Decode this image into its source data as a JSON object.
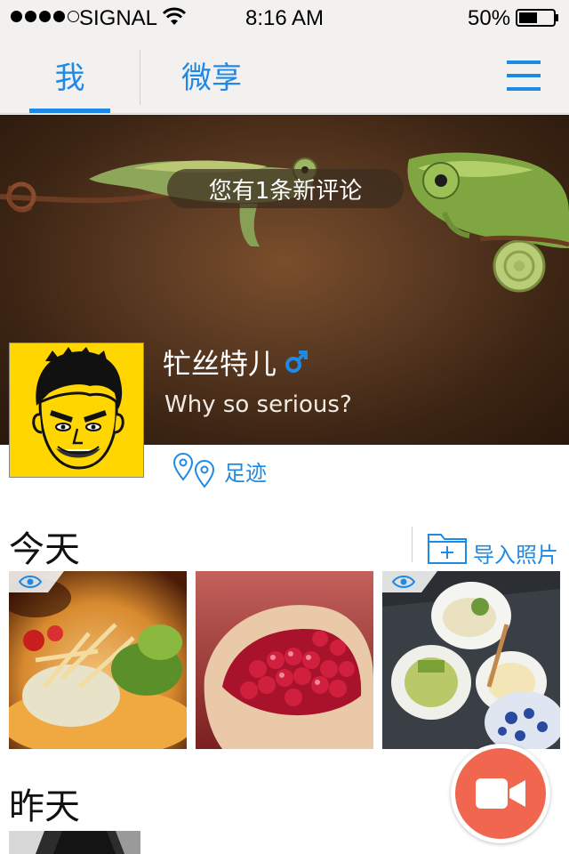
{
  "status_bar": {
    "carrier": "SIGNAL",
    "time": "8:16 AM",
    "battery": "50%"
  },
  "nav": {
    "tabs": [
      {
        "label": "我",
        "active": true
      },
      {
        "label": "微享",
        "active": false
      }
    ],
    "menu_icon": "hamburger-icon"
  },
  "profile": {
    "notification": "您有1条新评论",
    "name": "牤丝特儿",
    "gender_icon": "male-symbol-icon",
    "motto": "Why so serious?",
    "footprint_label": "足迹",
    "footprint_icon": "map-pin-icon"
  },
  "today": {
    "title": "今天",
    "import_label": "导入照片",
    "import_icon": "folder-plus-icon",
    "photos": [
      {
        "subject": "salad dish",
        "eye_badge": true
      },
      {
        "subject": "pomegranate",
        "eye_badge": false
      },
      {
        "subject": "japanese dishes",
        "eye_badge": true
      }
    ]
  },
  "yesterday": {
    "title": "昨天"
  },
  "record_icon": "video-camera-icon",
  "colors": {
    "accent": "#1f8ae6",
    "record": "#f0664f",
    "avatar_bg": "#ffd600"
  }
}
